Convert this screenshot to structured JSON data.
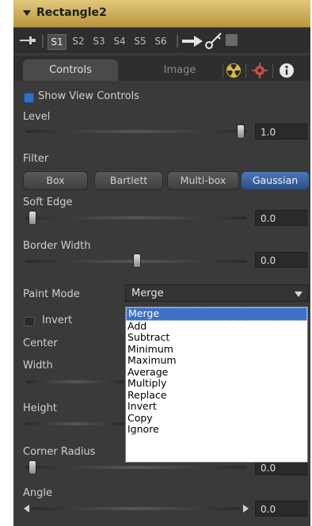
{
  "header": {
    "title": "Rectangle2"
  },
  "views": {
    "s1": "S1",
    "s2": "S2",
    "s3": "S3",
    "s4": "S4",
    "s5": "S5",
    "s6": "S6"
  },
  "tabs": {
    "controls": "Controls",
    "image": "Image"
  },
  "controls": {
    "show_view_controls": "Show View Controls",
    "level_label": "Level",
    "level_value": "1.0",
    "level_fraction": 0.97,
    "filter_label": "Filter",
    "filter_options": [
      "Box",
      "Bartlett",
      "Multi-box",
      "Gaussian"
    ],
    "filter_selected": "Gaussian",
    "soft_edge_label": "Soft Edge",
    "soft_edge_value": "0.0",
    "border_width_label": "Border Width",
    "border_width_value": "0.0",
    "paint_mode_label": "Paint Mode",
    "paint_mode_value": "Merge",
    "paint_mode_options": [
      "Merge",
      "Add",
      "Subtract",
      "Minimum",
      "Maximum",
      "Average",
      "Multiply",
      "Replace",
      "Invert",
      "Copy",
      "Ignore"
    ],
    "invert_label": "Invert",
    "center_label": "Center",
    "width_label": "Width",
    "height_label": "Height",
    "corner_radius_label": "Corner Radius",
    "corner_radius_value": "0.0",
    "angle_label": "Angle",
    "angle_value": "0.0"
  },
  "colors": {
    "header_gold": "#c9a64f",
    "accent_blue": "#2d72c7",
    "panel_bg": "#3c3c3c"
  },
  "icons": {
    "pin": "pin-icon",
    "view_arrow": "arrow-right-icon",
    "key": "key-icon",
    "save": "save-icon",
    "radioactive": "radioactive-icon",
    "settings": "gear-icon",
    "info": "info-icon"
  }
}
